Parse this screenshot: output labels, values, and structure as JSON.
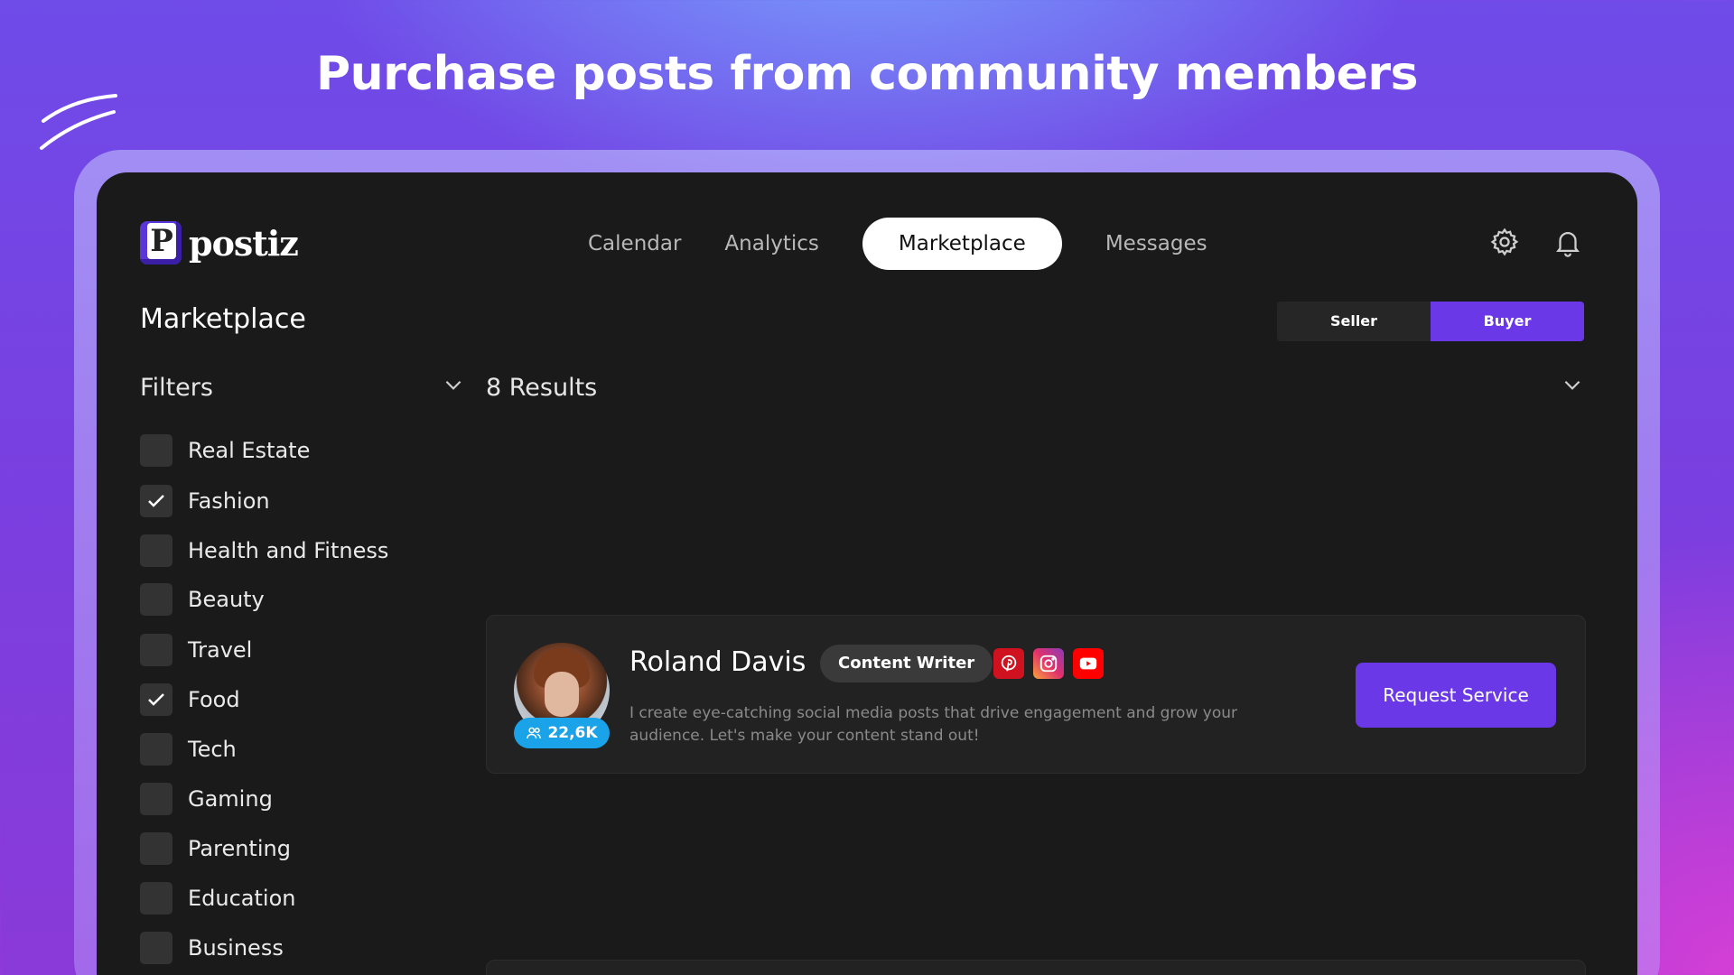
{
  "headline": "Purchase posts from community members",
  "app": {
    "logo_letter": "P",
    "logo_text": "postiz",
    "nav": [
      {
        "label": "Calendar"
      },
      {
        "label": "Analytics"
      },
      {
        "label": "Marketplace",
        "active": true
      },
      {
        "label": "Messages"
      }
    ],
    "icons": {
      "settings": "gear-icon",
      "notifications": "bell-icon"
    }
  },
  "page": {
    "title": "Marketplace",
    "role_toggle": {
      "seller": "Seller",
      "buyer": "Buyer",
      "selected": "Buyer"
    }
  },
  "filters": {
    "title": "Filters",
    "items": [
      {
        "label": "Real Estate",
        "checked": false
      },
      {
        "label": "Fashion",
        "checked": true
      },
      {
        "label": "Health and Fitness",
        "checked": false
      },
      {
        "label": "Beauty",
        "checked": false
      },
      {
        "label": "Travel",
        "checked": false
      },
      {
        "label": "Food",
        "checked": true
      },
      {
        "label": "Tech",
        "checked": false
      },
      {
        "label": "Gaming",
        "checked": false
      },
      {
        "label": "Parenting",
        "checked": false
      },
      {
        "label": "Education",
        "checked": false
      },
      {
        "label": "Business",
        "checked": false
      }
    ]
  },
  "results": {
    "count_label": "8 Results",
    "cards": [
      {
        "name": "Roland Davis",
        "role": "Content Writer",
        "followers": "22,6K",
        "socials": [
          "pinterest-icon",
          "instagram-icon",
          "youtube-icon"
        ],
        "description": "I create eye-catching social media posts that drive engagement and grow your audience. Let's make your content stand out!",
        "cta": "Request Service"
      }
    ]
  },
  "colors": {
    "accent": "#6a38e6",
    "background": "#1a1a1a",
    "followers_badge": "#1aa3e8"
  }
}
